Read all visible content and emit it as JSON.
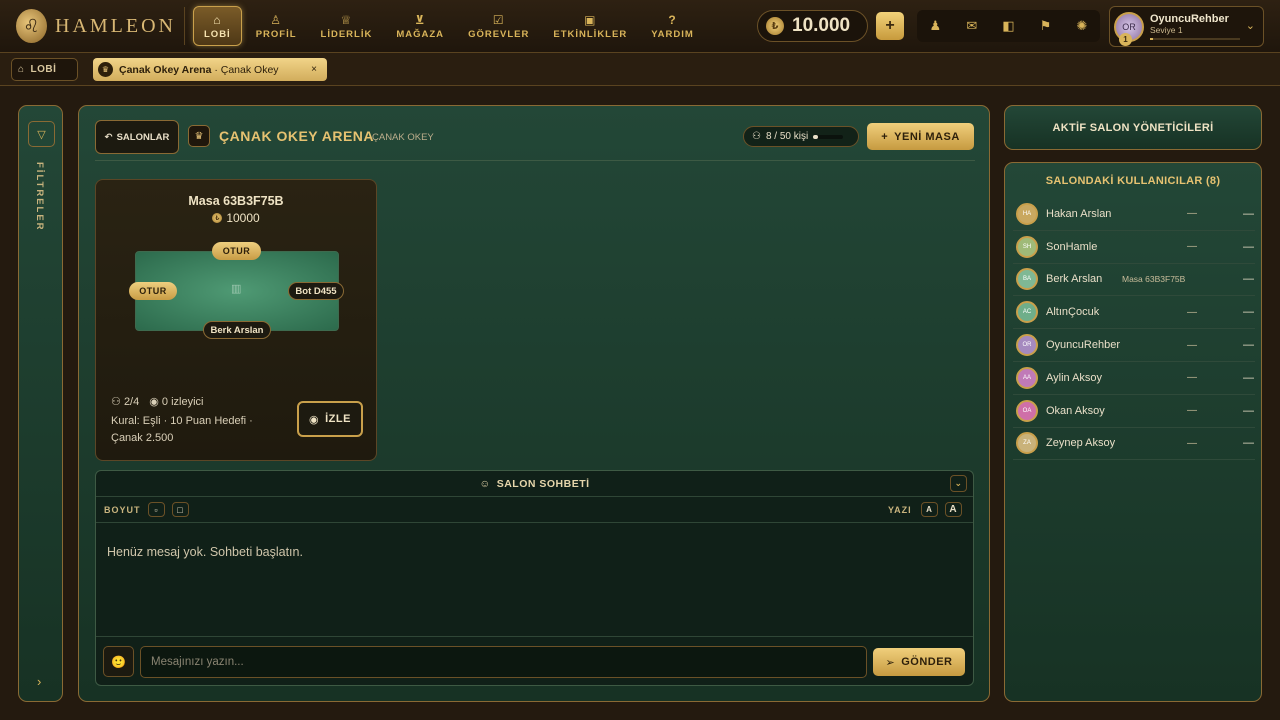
{
  "app": {
    "name": "HAMLEON"
  },
  "nav": [
    {
      "label": "LOBİ",
      "icon": "home-icon",
      "glyph": "⌂",
      "active": true
    },
    {
      "label": "PROFİL",
      "icon": "user-icon",
      "glyph": "♙",
      "active": false
    },
    {
      "label": "LİDERLİK",
      "icon": "trophy-icon",
      "glyph": "♕",
      "active": false
    },
    {
      "label": "MAĞAZA",
      "icon": "cart-icon",
      "glyph": "⊻",
      "active": false
    },
    {
      "label": "GÖREVLER",
      "icon": "clipboard-icon",
      "glyph": "☑",
      "active": false
    },
    {
      "label": "ETKİNLİKLER",
      "icon": "gift-icon",
      "glyph": "▣",
      "active": false
    },
    {
      "label": "YARDIM",
      "icon": "help-icon",
      "glyph": "?",
      "active": false
    }
  ],
  "wallet": {
    "balance": "10.000",
    "add_label": "+"
  },
  "quick_icons": [
    {
      "name": "friends-icon",
      "glyph": "♟"
    },
    {
      "name": "mail-icon",
      "glyph": "✉"
    },
    {
      "name": "gift-icon",
      "glyph": "◧"
    },
    {
      "name": "flag-icon",
      "glyph": "⚑"
    },
    {
      "name": "settings-icon",
      "glyph": "✺"
    }
  ],
  "profile": {
    "name": "OyuncuRehber",
    "level_text": "Seviye 1",
    "level_badge": "1",
    "initials": "OR",
    "xp_progress": 0.03
  },
  "breadcrumb": {
    "home_label": "LOBİ"
  },
  "tab": {
    "title_bold": "Çanak Okey Arena",
    "title_rest": "· Çanak Okey",
    "close": "×"
  },
  "filters": {
    "label": "FİLTRELER",
    "expand": "›"
  },
  "salon": {
    "back_label": "SALONLAR",
    "name": "ÇANAK OKEY ARENA",
    "subtitle": "ÇANAK OKEY",
    "capacity_text": "8 / 50 kişi",
    "capacity_fraction": 0.16,
    "new_table_label": "YENİ MASA"
  },
  "table_card": {
    "title": "Masa 63B3F75B",
    "bet": "10000",
    "seat_top": "OTUR",
    "seat_left": "OTUR",
    "seat_right": "Bot D455",
    "seat_bottom": "Berk Arslan",
    "players": "2/4",
    "spectators": "0 izleyici",
    "rules": "Kural: Eşli · 10 Puan Hedefi · Çanak 2.500",
    "watch_label": "İZLE"
  },
  "chat": {
    "title": "SALON SOHBETİ",
    "size_label": "BOYUT",
    "text_label": "YAZI",
    "font_small": "A",
    "font_large": "A",
    "empty_text": "Henüz mesaj yok. Sohbeti başlatın.",
    "input_placeholder": "Mesajınızı yazın...",
    "send_label": "GÖNDER"
  },
  "admins": {
    "title": "AKTİF SALON YÖNETİCİLERİ"
  },
  "users": {
    "title": "SALONDAKİ KULLANICILAR (8)",
    "list": [
      {
        "name": "Hakan Arslan",
        "initials": "HA",
        "table": "—",
        "color": "#c9a860"
      },
      {
        "name": "SonHamle",
        "initials": "SH",
        "table": "—",
        "color": "#9fba78"
      },
      {
        "name": "Berk Arslan",
        "initials": "BA",
        "table": "Masa 63B3F75B",
        "color": "#7fb894"
      },
      {
        "name": "AltınÇocuk",
        "initials": "AC",
        "table": "—",
        "color": "#6fae8a"
      },
      {
        "name": "OyuncuRehber",
        "initials": "OR",
        "table": "—",
        "color": "#a58abf"
      },
      {
        "name": "Aylin Aksoy",
        "initials": "AA",
        "table": "—",
        "color": "#c07ab8"
      },
      {
        "name": "Okan Aksoy",
        "initials": "OA",
        "table": "—",
        "color": "#cf6fa8"
      },
      {
        "name": "Zeynep Aksoy",
        "initials": "ZA",
        "table": "—",
        "color": "#c9b27a"
      }
    ],
    "dash": "—"
  }
}
